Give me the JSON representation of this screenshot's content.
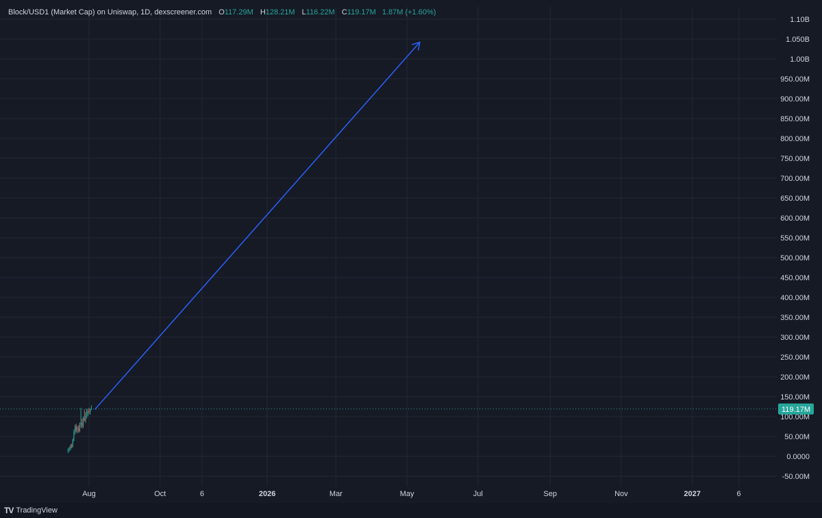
{
  "legend": {
    "title": "Block/USD1 (Market Cap) on Uniswap, 1D, dexscreener.com",
    "open_key": "O",
    "open": "117.29M",
    "high_key": "H",
    "high": "128.21M",
    "low_key": "L",
    "low": "116.22M",
    "close_key": "C",
    "close": "119.17M",
    "change": "1.87M (+1.60%)"
  },
  "footer": {
    "logo_mark": "TV",
    "brand": "TradingView"
  },
  "colors": {
    "background": "#161a25",
    "grid": "#242836",
    "axis_text": "#d1d4dc",
    "up": "#26a69a",
    "down": "#ef5350",
    "arrow": "#2962ff",
    "price_tag": "#26a69a"
  },
  "chart_data": {
    "type": "candlestick",
    "y_axis": {
      "ticks": [
        {
          "value": 1100,
          "label": "1.10B"
        },
        {
          "value": 1050,
          "label": "1.050B"
        },
        {
          "value": 1000,
          "label": "1.00B"
        },
        {
          "value": 950,
          "label": "950.00M"
        },
        {
          "value": 900,
          "label": "900.00M"
        },
        {
          "value": 850,
          "label": "850.00M"
        },
        {
          "value": 800,
          "label": "800.00M"
        },
        {
          "value": 750,
          "label": "750.00M"
        },
        {
          "value": 700,
          "label": "700.00M"
        },
        {
          "value": 650,
          "label": "650.00M"
        },
        {
          "value": 600,
          "label": "600.00M"
        },
        {
          "value": 550,
          "label": "550.00M"
        },
        {
          "value": 500,
          "label": "500.00M"
        },
        {
          "value": 450,
          "label": "450.00M"
        },
        {
          "value": 400,
          "label": "400.00M"
        },
        {
          "value": 350,
          "label": "350.00M"
        },
        {
          "value": 300,
          "label": "300.00M"
        },
        {
          "value": 250,
          "label": "250.00M"
        },
        {
          "value": 200,
          "label": "200.00M"
        },
        {
          "value": 150,
          "label": "150.00M"
        },
        {
          "value": 100,
          "label": "100.00M"
        },
        {
          "value": 50,
          "label": "50.00M"
        },
        {
          "value": 0,
          "label": "0.0000"
        },
        {
          "value": -50,
          "label": "-50.00M"
        }
      ],
      "unit": "M"
    },
    "x_axis": {
      "ticks": [
        {
          "day": 0,
          "label": "Aug",
          "bold": false
        },
        {
          "day": 61,
          "label": "Oct",
          "bold": false
        },
        {
          "day": 97,
          "label": "6",
          "bold": false
        },
        {
          "day": 153,
          "label": "2026",
          "bold": true
        },
        {
          "day": 212,
          "label": "Mar",
          "bold": false
        },
        {
          "day": 273,
          "label": "May",
          "bold": false
        },
        {
          "day": 334,
          "label": "Jul",
          "bold": false
        },
        {
          "day": 396,
          "label": "Sep",
          "bold": false
        },
        {
          "day": 457,
          "label": "Nov",
          "bold": false
        },
        {
          "day": 518,
          "label": "2027",
          "bold": true
        },
        {
          "day": 558,
          "label": "6",
          "bold": false
        }
      ]
    },
    "candles": [
      {
        "d": -18,
        "o": 14,
        "h": 20,
        "l": 8,
        "c": 17
      },
      {
        "d": -17,
        "o": 17,
        "h": 24,
        "l": 12,
        "c": 20
      },
      {
        "d": -16,
        "o": 20,
        "h": 30,
        "l": 15,
        "c": 27
      },
      {
        "d": -15,
        "o": 27,
        "h": 32,
        "l": 20,
        "c": 24
      },
      {
        "d": -14,
        "o": 24,
        "h": 45,
        "l": 22,
        "c": 42
      },
      {
        "d": -13,
        "o": 42,
        "h": 68,
        "l": 38,
        "c": 62
      },
      {
        "d": -12,
        "o": 62,
        "h": 80,
        "l": 55,
        "c": 75
      },
      {
        "d": -11,
        "o": 75,
        "h": 82,
        "l": 60,
        "c": 66
      },
      {
        "d": -10,
        "o": 66,
        "h": 76,
        "l": 58,
        "c": 71
      },
      {
        "d": -9,
        "o": 71,
        "h": 78,
        "l": 60,
        "c": 64
      },
      {
        "d": -8,
        "o": 64,
        "h": 85,
        "l": 60,
        "c": 80
      },
      {
        "d": -7,
        "o": 80,
        "h": 122,
        "l": 72,
        "c": 85
      },
      {
        "d": -6,
        "o": 85,
        "h": 95,
        "l": 70,
        "c": 76
      },
      {
        "d": -5,
        "o": 76,
        "h": 100,
        "l": 72,
        "c": 96
      },
      {
        "d": -4,
        "o": 96,
        "h": 118,
        "l": 88,
        "c": 90
      },
      {
        "d": -3,
        "o": 90,
        "h": 112,
        "l": 84,
        "c": 104
      },
      {
        "d": -2,
        "o": 104,
        "h": 120,
        "l": 95,
        "c": 108
      },
      {
        "d": -1,
        "o": 108,
        "h": 118,
        "l": 100,
        "c": 114
      },
      {
        "d": 0,
        "o": 114,
        "h": 122,
        "l": 106,
        "c": 112
      },
      {
        "d": 1,
        "o": 112,
        "h": 120,
        "l": 105,
        "c": 117
      },
      {
        "d": 2,
        "o": 117.29,
        "h": 128.21,
        "l": 116.22,
        "c": 119.17
      }
    ],
    "last_price": {
      "value": 119.17,
      "label": "119.17M"
    },
    "annotation": {
      "type": "arrow",
      "from": {
        "day": 5,
        "value": 118
      },
      "to": {
        "day": 284,
        "value": 1042
      }
    }
  }
}
